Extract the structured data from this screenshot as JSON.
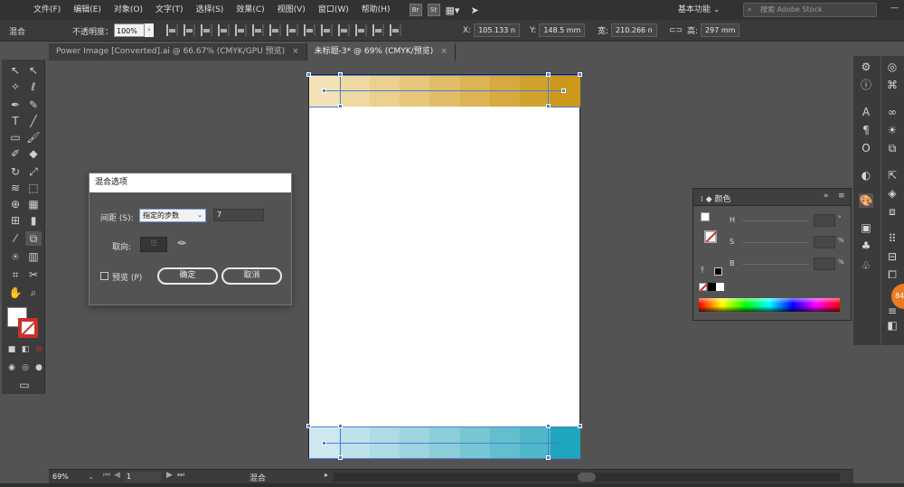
{
  "menubar": {
    "items": [
      "文件(F)",
      "编辑(E)",
      "对象(O)",
      "文字(T)",
      "选择(S)",
      "效果(C)",
      "视图(V)",
      "窗口(W)",
      "帮助(H)"
    ],
    "app_icons": [
      "Br",
      "St"
    ],
    "workspace": "基本功能",
    "search_placeholder": "搜索 Adobe Stock"
  },
  "controlbar": {
    "mode": "混合",
    "opacity_label": "不透明度：",
    "opacity_value": "100%",
    "x_label": "X:",
    "x_value": "105.133 n",
    "y_label": "Y:",
    "y_value": "148.5 mm",
    "w_label": "宽:",
    "w_value": "210.266 n",
    "h_label": "高:",
    "h_value": "297 mm"
  },
  "tabs": [
    {
      "label": "Power Image [Converted].ai @ 66.67% (CMYK/GPU 预览)",
      "close": "×"
    },
    {
      "label": "未标题-3* @ 69% (CMYK/预览)",
      "close": "×"
    }
  ],
  "dialog": {
    "title": "混合选项",
    "spacing_label": "间距 (S):",
    "spacing_value": "指定的步数",
    "steps_value": "7",
    "orientation_label": "取向:",
    "preview_label": "预览 (P)",
    "ok_label": "确定",
    "cancel_label": "取消"
  },
  "color_panel": {
    "title": "颜色",
    "rows": [
      {
        "key": "H",
        "unit": "°"
      },
      {
        "key": "S",
        "unit": "%"
      },
      {
        "key": "B",
        "unit": "%"
      }
    ]
  },
  "statusbar": {
    "zoom": "69%",
    "page": "1",
    "status": "混合"
  },
  "badge": "84",
  "blend": {
    "top_colors": [
      "#f3e2b6",
      "#efd9a2",
      "#ebd08e",
      "#e6c77b",
      "#e1bd67",
      "#dcb454",
      "#d6aa40",
      "#d1a12d",
      "#cc981a"
    ],
    "bottom_colors": [
      "#cfe8ef",
      "#bfe2ea",
      "#afdbe5",
      "#9dd4df",
      "#8bcdd9",
      "#77c6d3",
      "#63bfcd",
      "#4fb8c8",
      "#1ea6bc"
    ]
  },
  "colors": {
    "selection": "#4d7dd6",
    "stroke_red": "#c8322c",
    "badge_orange": "#ec7b21"
  }
}
